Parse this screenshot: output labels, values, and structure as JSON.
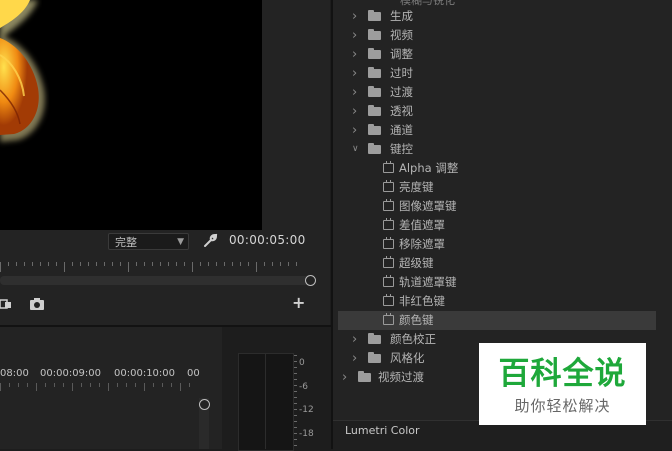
{
  "monitor": {
    "quality": "完整",
    "timecode": "00:00:05:00",
    "add_label": "+"
  },
  "timeline": {
    "times": [
      "08:00",
      "00:00:09:00",
      "00:00:10:00",
      "00"
    ]
  },
  "meter": {
    "db_labels": [
      "0",
      "-6",
      "-12",
      "-18"
    ]
  },
  "effects": {
    "cut_label": "模糊与锐化",
    "items": [
      {
        "label": "生成",
        "type": "folder"
      },
      {
        "label": "视频",
        "type": "folder"
      },
      {
        "label": "调整",
        "type": "folder"
      },
      {
        "label": "过时",
        "type": "folder"
      },
      {
        "label": "过渡",
        "type": "folder"
      },
      {
        "label": "透视",
        "type": "folder"
      },
      {
        "label": "通道",
        "type": "folder"
      },
      {
        "label": "键控",
        "type": "folder-open"
      },
      {
        "label": "Alpha 调整",
        "type": "effect"
      },
      {
        "label": "亮度键",
        "type": "effect"
      },
      {
        "label": "图像遮罩键",
        "type": "effect"
      },
      {
        "label": "差值遮罩",
        "type": "effect"
      },
      {
        "label": "移除遮罩",
        "type": "effect"
      },
      {
        "label": "超级键",
        "type": "effect"
      },
      {
        "label": "轨道遮罩键",
        "type": "effect"
      },
      {
        "label": "非红色键",
        "type": "effect"
      },
      {
        "label": "颜色键",
        "type": "effect",
        "selected": true
      },
      {
        "label": "颜色校正",
        "type": "folder"
      },
      {
        "label": "风格化",
        "type": "folder"
      },
      {
        "label": "视频过渡",
        "type": "folder-root"
      }
    ],
    "lumetri_label": "Lumetri Color"
  },
  "watermark": {
    "title": "百科全说",
    "subtitle": "助你轻松解决"
  },
  "colors": {
    "accent_green": "#1ea83a",
    "selected_row": "#3a3a3a"
  }
}
